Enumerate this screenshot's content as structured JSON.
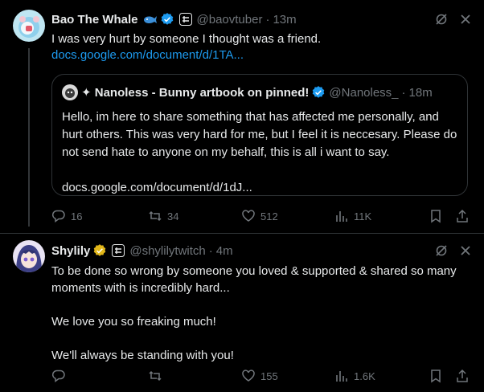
{
  "tweet1": {
    "name": "Bao The Whale",
    "handle": "@baovtuber",
    "dot": "·",
    "time": "13m",
    "text": "I was very hurt by someone I thought was a friend.",
    "link": "docs.google.com/document/d/1TA...",
    "quote": {
      "name": "✦ Nanoless - Bunny artbook on pinned!",
      "handle": "@Nanoless_",
      "dot": "·",
      "time": "18m",
      "text": "Hello, im here to share something that has affected me personally, and hurt others. This was very hard for me, but I feel it is neccesary. Please do not send hate to anyone on my behalf, this is all i want to say.",
      "link": "docs.google.com/document/d/1dJ..."
    },
    "actions": {
      "replies": "16",
      "reposts": "34",
      "likes": "512",
      "views": "11K"
    }
  },
  "tweet2": {
    "name": "Shylily",
    "handle": "@shylilytwitch",
    "dot": "·",
    "time": "4m",
    "lines": [
      "To be done so wrong by someone you loved & supported & shared so many moments with is incredibly hard...",
      "We love you so freaking much!",
      "We'll always be standing with you!"
    ],
    "actions": {
      "replies": "",
      "reposts": "",
      "likes": "155",
      "views": "1.6K"
    }
  },
  "colors": {
    "accent": "#1d9bf0",
    "muted": "#71767b",
    "gold": "#e2b719",
    "background": "#000000"
  }
}
